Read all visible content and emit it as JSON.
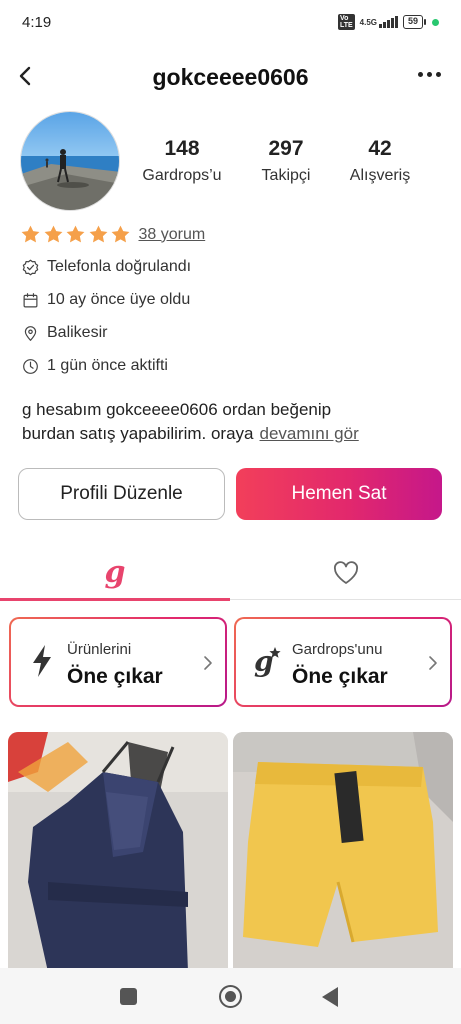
{
  "status_bar": {
    "time": "4:19",
    "volte": "Vo LTE",
    "network": "4.5G",
    "battery": "59"
  },
  "header": {
    "username": "gokceeee0606",
    "back_icon": "chevron-left-icon",
    "more_icon": "more-horizontal-icon"
  },
  "profile": {
    "avatar_icon": "profile-photo",
    "stats": [
      {
        "value": "148",
        "label": "Gardrops’u"
      },
      {
        "value": "297",
        "label": "Takipçi"
      },
      {
        "value": "42",
        "label": "Alışveriş"
      }
    ],
    "rating": {
      "stars": 5,
      "max_stars": 5,
      "star_color": "#f5a04a",
      "reviews_link": "38 yorum"
    },
    "info": [
      {
        "icon": "verified-badge-icon",
        "text": "Telefonla doğrulandı"
      },
      {
        "icon": "calendar-icon",
        "text": "10 ay önce üye oldu"
      },
      {
        "icon": "location-pin-icon",
        "text": "Balikesir"
      },
      {
        "icon": "clock-icon",
        "text": "1 gün önce aktifti"
      }
    ],
    "bio": {
      "line1": "g hesabım gokceeee0606 ordan beğenip",
      "line2": "burdan satış yapabilirim. oraya",
      "more_link": "devamını gör"
    }
  },
  "actions": {
    "edit_profile": "Profili Düzenle",
    "sell_now": "Hemen Sat"
  },
  "tabs": [
    {
      "name": "closet",
      "icon": "gardrops-logo-icon",
      "glyph": "g",
      "active": true
    },
    {
      "name": "favorites",
      "icon": "heart-icon",
      "active": false
    }
  ],
  "promos": [
    {
      "icon": "lightning-icon",
      "line1": "Ürünlerini",
      "line2": "Öne çıkar"
    },
    {
      "icon": "gardrops-star-icon",
      "line1": "Gardrops'unu",
      "line2": "Öne çıkar"
    }
  ],
  "products": [
    {
      "icon": "product-photo-navy-romper"
    },
    {
      "icon": "product-photo-yellow-shorts"
    }
  ],
  "colors": {
    "accent": "#e8446d",
    "button_gradient_start": "#f23f5a",
    "button_gradient_end": "#c5178a",
    "star": "#f5a04a",
    "status_green": "#28c76f"
  }
}
